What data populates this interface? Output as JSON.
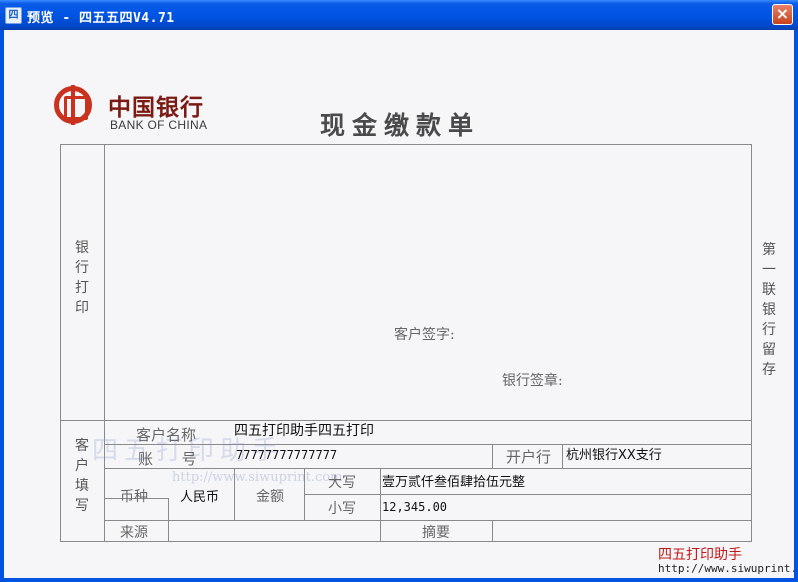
{
  "window": {
    "title": "预览 - 四五五四V4.71",
    "app_icon_text": "四",
    "close_label": "×"
  },
  "slip": {
    "bank_name_cn": "中国银行",
    "bank_name_en": "BANK OF CHINA",
    "title": "现金缴款单",
    "bank_print_label": "银行打印",
    "side_note": "第一联 银行留存",
    "customer_sign": "客户签字:",
    "bank_stamp": "银行签章:",
    "customer_fill_label": "客户填写",
    "labels": {
      "customer_name": "客户名称",
      "account": "账      号",
      "open_bank": "开户行",
      "currency": "币种",
      "amount": "金额",
      "uppercase": "大写",
      "lowercase": "小写",
      "source": "来源",
      "summary": "摘要"
    },
    "values": {
      "customer_name": "四五打印助手四五打印",
      "account": "77777777777777",
      "open_bank": "杭州银行XX支行",
      "currency": "人民币",
      "amount_upper": "壹万贰仟叁佰肆拾伍元整",
      "amount_lower": "12,345.00"
    }
  },
  "watermark": {
    "text": "四五打印助手",
    "url": "http://www.siwuprint.com"
  },
  "footer": {
    "brand": "四五打印助手",
    "url": "http://www.siwuprint.co"
  }
}
